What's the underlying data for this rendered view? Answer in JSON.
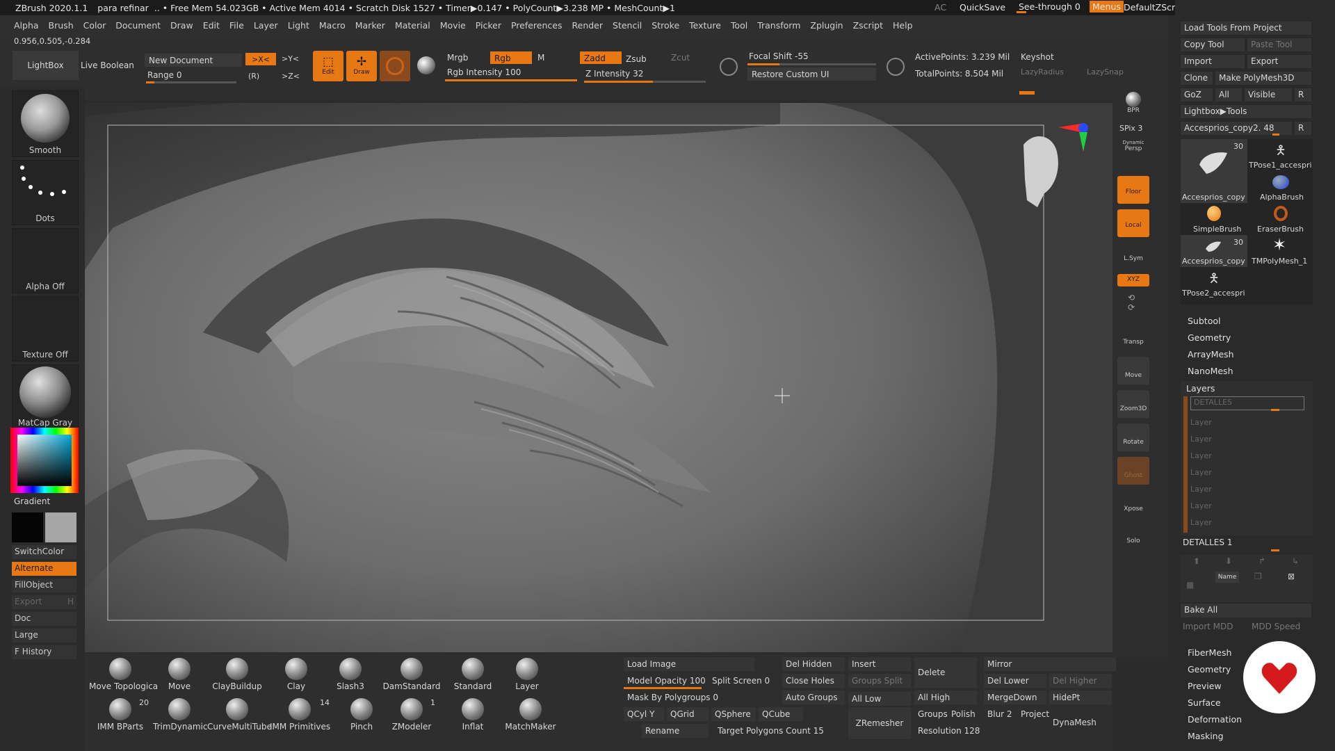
{
  "title": {
    "app": "ZBrush 2020.1.1",
    "doc": "para refinar",
    "stats": ".. • Free Mem 54.023GB • Active Mem 4014 • Scratch Disk 1527 • Timer▶0.147 • PolyCount▶3.238 MP • MeshCount▶1",
    "ac": "AC",
    "quicksave": "QuickSave",
    "seethrough": "See-through  0",
    "menus": "Menus",
    "script": "DefaultZScript"
  },
  "menu": [
    "Alpha",
    "Brush",
    "Color",
    "Document",
    "Draw",
    "Edit",
    "File",
    "Layer",
    "Light",
    "Macro",
    "Marker",
    "Material",
    "Movie",
    "Picker",
    "Preferences",
    "Render",
    "Stencil",
    "Stroke",
    "Texture",
    "Tool",
    "Transform",
    "Zplugin",
    "Zscript",
    "Help"
  ],
  "coords": "0.956,0.505,-0.284",
  "toolbar": {
    "lightbox": "LightBox",
    "live_boolean": "Live Boolean",
    "new_document": "New Document",
    "range": "Range 0",
    "sym_x": ">X<",
    "sym_y": ">Y<",
    "sym_r": "(R)",
    "sym_z": ">Z<",
    "edit": "Edit",
    "draw": "Draw",
    "mrgb": "Mrgb",
    "rgb": "Rgb",
    "m": "M",
    "rgb_intensity": "Rgb Intensity 100",
    "zadd": "Zadd",
    "zsub": "Zsub",
    "zcut": "Zcut",
    "z_intensity": "Z Intensity 32",
    "focal_shift": "Focal Shift -55",
    "restore_ui": "Restore Custom UI",
    "active_points": "ActivePoints: 3.239 Mil",
    "total_points": "TotalPoints: 8.504 Mil",
    "keyshot": "Keyshot",
    "lazy_radius": "LazyRadius",
    "lazy_snap": "LazySnap"
  },
  "left": {
    "smooth": "Smooth",
    "dots": "Dots",
    "alpha_off": "Alpha Off",
    "texture_off": "Texture Off",
    "matcap": "MatCap Gray",
    "gradient": "Gradient",
    "switchcolor": "SwitchColor",
    "alternate": "Alternate",
    "fillobject": "FillObject",
    "export": "Export",
    "export_h": "H",
    "doc": "Doc",
    "large": "Large",
    "fhistory": "F History"
  },
  "rightshelf": [
    "BPR",
    "SPix 3",
    "Persp",
    "Floor",
    "Local",
    "L.Sym",
    "XYZ",
    "Transp",
    "Move",
    "Zoom3D",
    "Rotate",
    "Ghost",
    "Xpose",
    "Solo"
  ],
  "rightshelf_dynamic": "Dynamic",
  "tool": {
    "load_tools": "Load Tools From Project",
    "copy_tool": "Copy Tool",
    "paste_tool": "Paste Tool",
    "import": "Import",
    "export": "Export",
    "clone": "Clone",
    "make_polymesh": "Make PolyMesh3D",
    "goz": "GoZ",
    "all": "All",
    "visible": "Visible",
    "r": "R",
    "lightbox_tools": "Lightbox▶Tools",
    "current": "Accesprios_copy2. 48",
    "tools": [
      {
        "name": "Accesprios_copy",
        "count": "30"
      },
      {
        "name": "TPose1_accespri",
        "count": ""
      },
      {
        "name": "AlphaBrush",
        "count": ""
      },
      {
        "name": "SimpleBrush",
        "count": ""
      },
      {
        "name": "EraserBrush",
        "count": ""
      },
      {
        "name": "Accesprios_copy",
        "count": "30"
      },
      {
        "name": "TMPolyMesh_1",
        "count": ""
      },
      {
        "name": "TPose2_accespri",
        "count": ""
      }
    ],
    "subtool": "Subtool",
    "geometry": "Geometry",
    "arraymesh": "ArrayMesh",
    "nanomesh": "NanoMesh",
    "layers": "Layers",
    "layer_active": "DETALLES",
    "layer_items": [
      "Layer",
      "Layer",
      "Layer",
      "Layer",
      "Layer",
      "Layer",
      "Layer"
    ],
    "detalles": "DETALLES 1",
    "name": "Name",
    "bake_all": "Bake All",
    "import_mdd": "Import MDD",
    "mdd_speed": "MDD Speed",
    "more": [
      "FiberMesh",
      "Geometry",
      "Preview",
      "Surface",
      "Deformation",
      "Masking"
    ]
  },
  "brushes": [
    {
      "name": "Move Topologica",
      "count": ""
    },
    {
      "name": "Move",
      "count": ""
    },
    {
      "name": "ClayBuildup",
      "count": ""
    },
    {
      "name": "Clay",
      "count": ""
    },
    {
      "name": "Slash3",
      "count": ""
    },
    {
      "name": "DamStandard",
      "count": ""
    },
    {
      "name": "Standard",
      "count": ""
    },
    {
      "name": "Layer",
      "count": ""
    },
    {
      "name": "IMM BParts",
      "count": "20"
    },
    {
      "name": "TrimDynamic",
      "count": ""
    },
    {
      "name": "CurveMultiTube",
      "count": ""
    },
    {
      "name": "IMM Primitives",
      "count": "14"
    },
    {
      "name": "Pinch",
      "count": ""
    },
    {
      "name": "ZModeler",
      "count": "1"
    },
    {
      "name": "Inflat",
      "count": ""
    },
    {
      "name": "MatchMaker",
      "count": ""
    }
  ],
  "cmds": {
    "load_image": "Load Image",
    "model_opacity": "Model Opacity 100",
    "split_screen": "Split Screen 0",
    "mask_polygroups": "Mask By Polygroups 0",
    "qcyl": "QCyl Y",
    "qgrid": "QGrid",
    "qsphere": "QSphere",
    "qcube": "QCube",
    "rename": "Rename",
    "target_poly": "Target Polygons Count 15",
    "del_hidden": "Del Hidden",
    "close_holes": "Close Holes",
    "auto_groups": "Auto Groups",
    "zremesher": "ZRemesher",
    "insert": "Insert",
    "groups_split": "Groups Split",
    "all_low": "All Low",
    "all_high": "All High",
    "delete": "Delete",
    "groups": "Groups",
    "polish": "Polish",
    "resolution": "Resolution 128",
    "mirror": "Mirror",
    "del_lower": "Del Lower",
    "del_higher": "Del Higher",
    "mergedown": "MergeDown",
    "hidept": "HidePt",
    "blur": "Blur 2",
    "project": "Project",
    "dynamesh": "DynaMesh"
  }
}
